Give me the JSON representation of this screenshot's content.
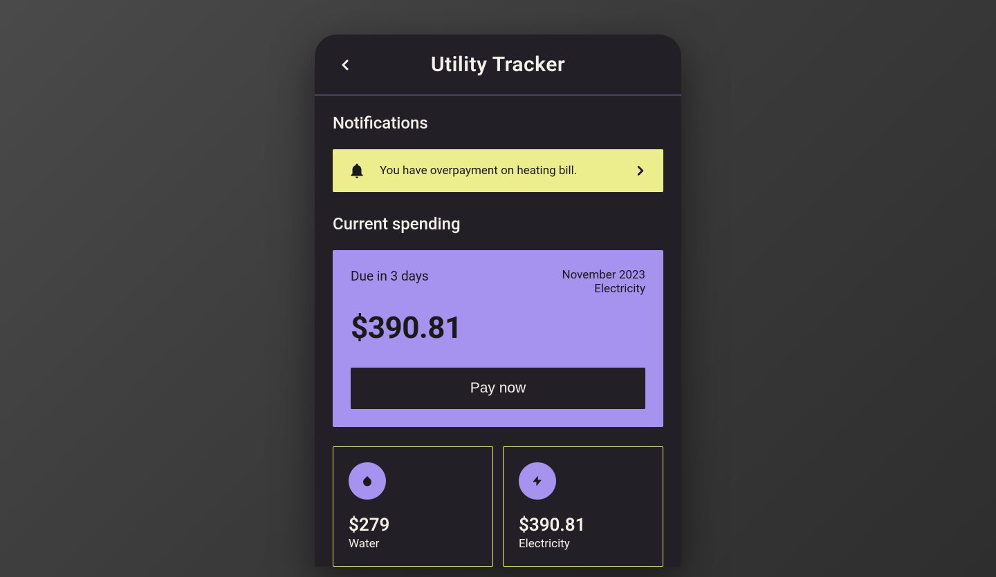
{
  "header": {
    "title": "Utility Tracker"
  },
  "notifications": {
    "heading": "Notifications",
    "banner_text": "You have overpayment on heating bill."
  },
  "current_spending": {
    "heading": "Current spending",
    "due_label": "Due in 3 days",
    "month": "November 2023",
    "category": "Electricity",
    "amount": "$390.81",
    "pay_button_label": "Pay now"
  },
  "utilities": [
    {
      "amount": "$279",
      "label": "Water",
      "icon": "water-drop"
    },
    {
      "amount": "$390.81",
      "label": "Electricity",
      "icon": "bolt"
    }
  ],
  "colors": {
    "background_dark": "#231f26",
    "accent_yellow": "#ecee8e",
    "accent_purple": "#a593ef",
    "text_light": "#f5f0e8",
    "text_dark": "#1a1a1a"
  }
}
